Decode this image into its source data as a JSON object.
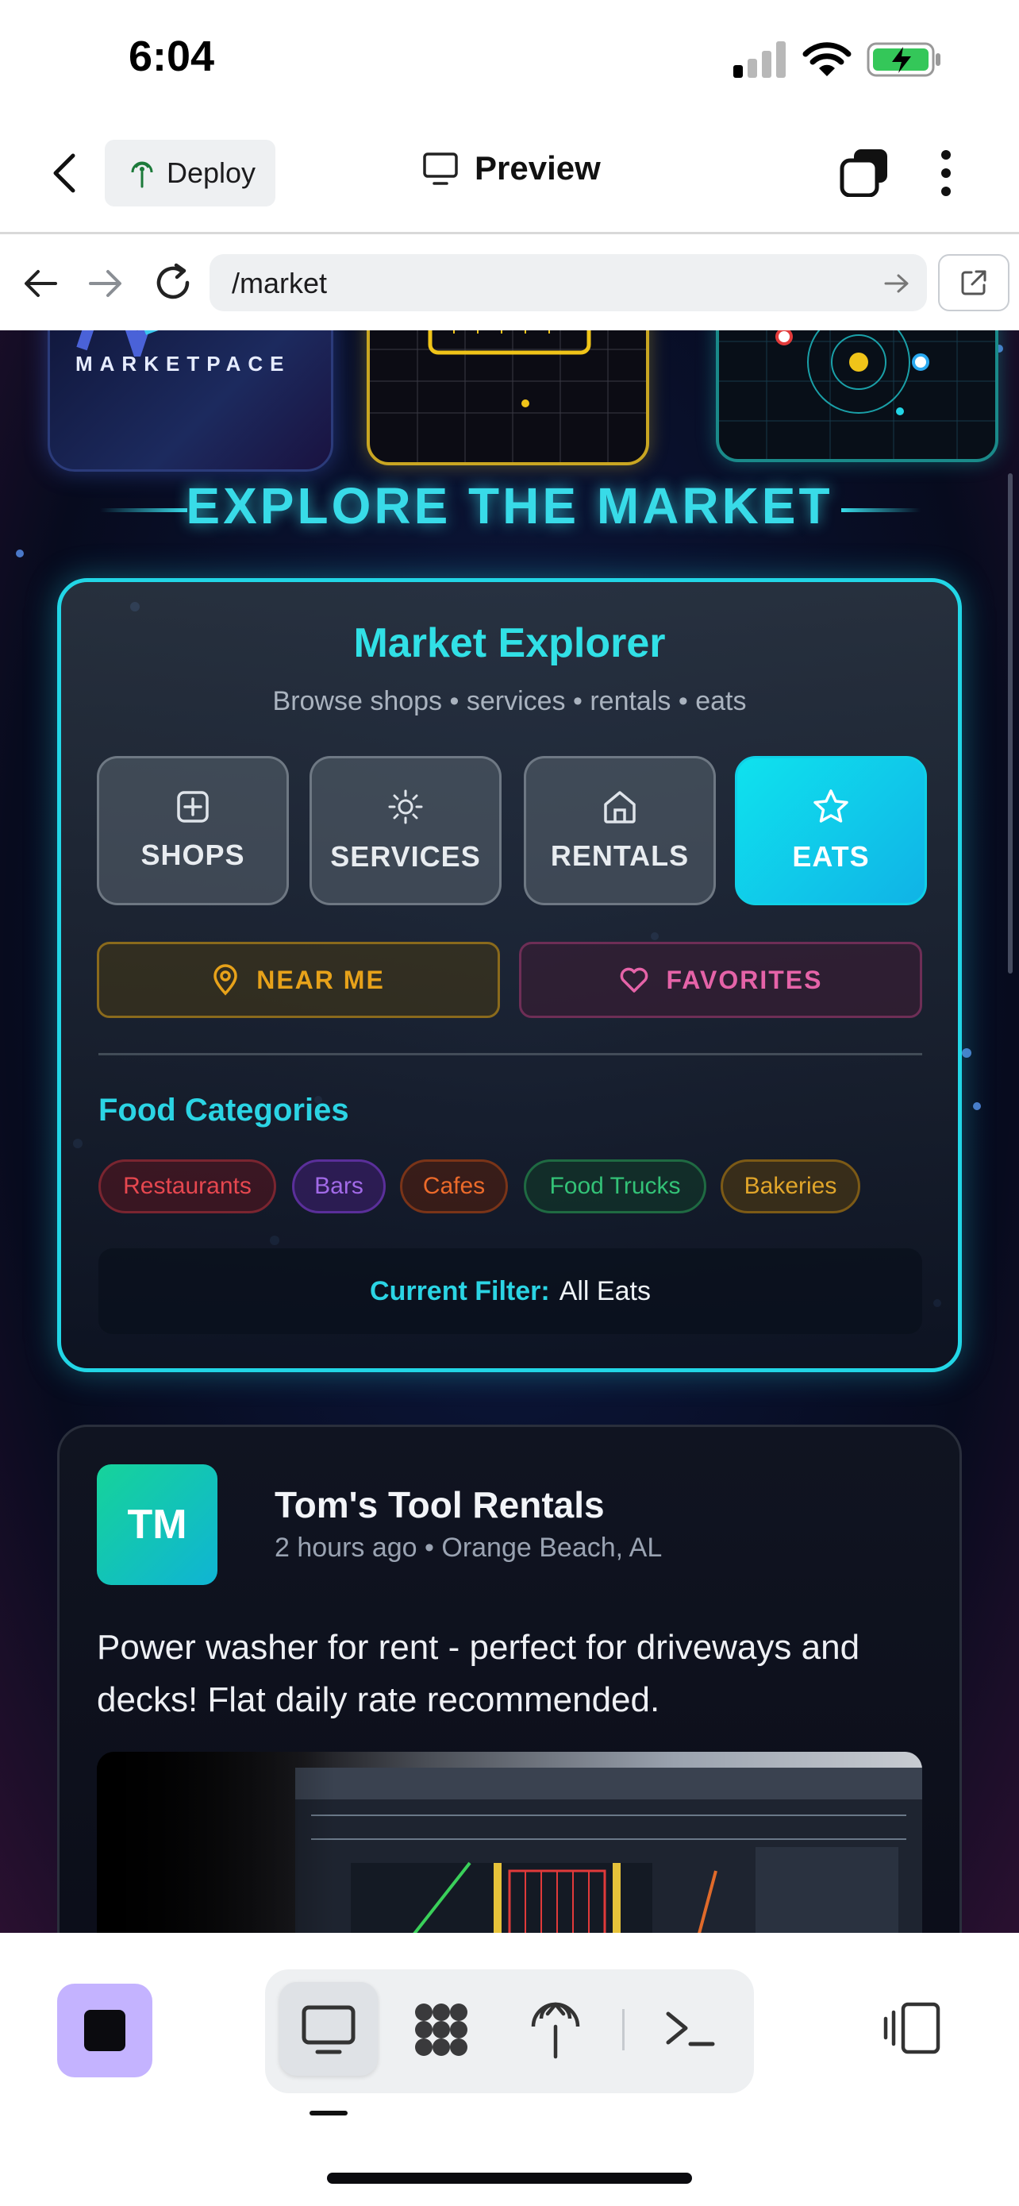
{
  "status_bar": {
    "time": "6:04"
  },
  "header": {
    "deploy_label": "Deploy",
    "preview_label": "Preview"
  },
  "browser": {
    "url": "/market"
  },
  "page": {
    "hero": {
      "wordmark": "MARKETPACE"
    },
    "section_title": "EXPLORE THE MARKET",
    "explorer": {
      "title": "Market Explorer",
      "subtitle": "Browse shops • services • rentals • eats",
      "categories": [
        {
          "label": "SHOPS",
          "icon": "plus-square-icon",
          "active": false
        },
        {
          "label": "SERVICES",
          "icon": "sun-icon",
          "active": false
        },
        {
          "label": "RENTALS",
          "icon": "home-icon",
          "active": false
        },
        {
          "label": "EATS",
          "icon": "star-icon",
          "active": true
        }
      ],
      "near_me": "NEAR ME",
      "favorites": "FAVORITES",
      "food_title": "Food Categories",
      "food_chips": [
        "Restaurants",
        "Bars",
        "Cafes",
        "Food Trucks",
        "Bakeries"
      ],
      "filter_label": "Current Filter:",
      "filter_value": "All Eats"
    },
    "post": {
      "initials": "TM",
      "author": "Tom's Tool Rentals",
      "meta": "2 hours ago • Orange Beach, AL",
      "body": "Power washer for rent - perfect for driveways and decks! Flat daily rate recommended."
    }
  },
  "colors": {
    "accent_cyan": "#22d6e6",
    "stop_button": "#c4b3ff",
    "near_me": "#e7a21a",
    "favorites": "#e563a8"
  }
}
